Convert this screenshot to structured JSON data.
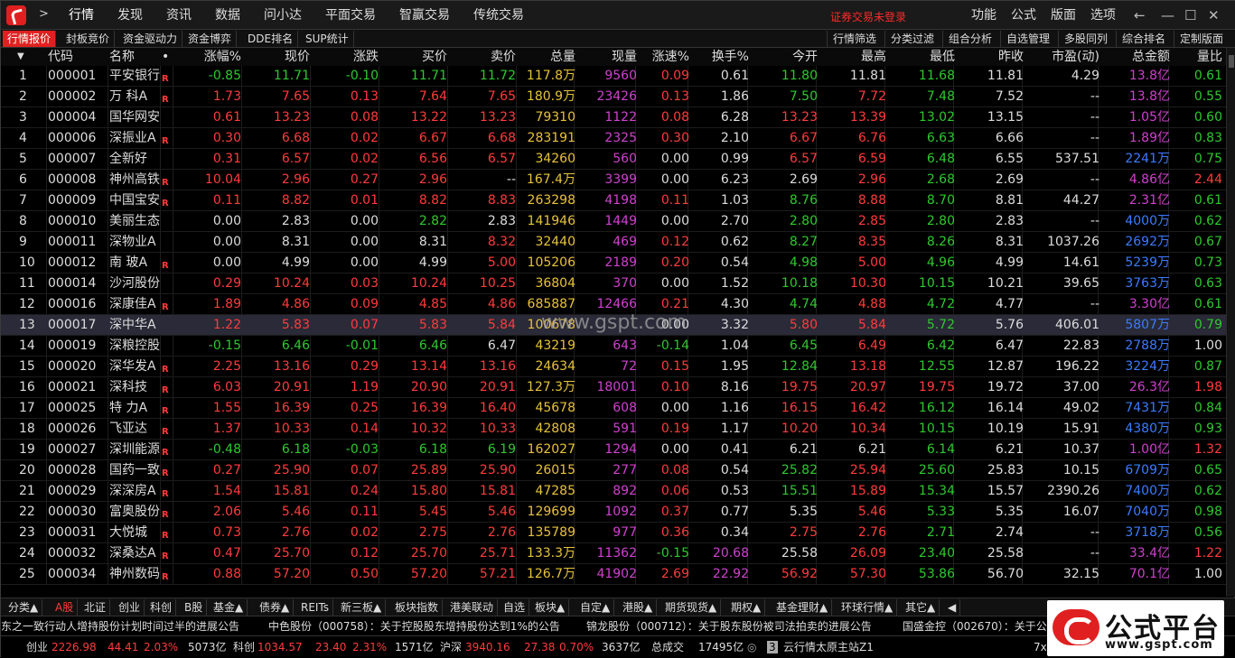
{
  "app": {
    "menu": [
      "行情",
      "发现",
      "资讯",
      "数据",
      "问小达",
      "平面交易",
      "智赢交易",
      "传统交易"
    ],
    "warning": "证券交易未登录",
    "right_menu": [
      "功能",
      "公式",
      "版面",
      "选项"
    ]
  },
  "tabs": [
    "行情报价",
    "封板竞价",
    "资金驱动力",
    "资金博弈",
    "DDE排名",
    "SUP统计"
  ],
  "right_tabs": [
    "行情筛选",
    "分类过滤",
    "组合分析",
    "自选管理",
    "多股同列",
    "综合排名",
    "定制版面"
  ],
  "columns": [
    "",
    "代码",
    "名称",
    "•",
    "涨幅%",
    "现价",
    "涨跌",
    "买价",
    "卖价",
    "总量",
    "现量",
    "涨速%",
    "换手%",
    "今开",
    "最高",
    "最低",
    "昨收",
    "市盈(动)",
    "总金额",
    "量比"
  ],
  "rows": [
    {
      "n": "1",
      "code": "000001",
      "name": "平安银行",
      "r": "R",
      "pct": "-0.85",
      "price": "11.71",
      "chg": "-0.10",
      "bid": "11.71",
      "ask": "11.72",
      "vol": "117.8万",
      "cur": "9560",
      "spd": "0.09",
      "turn": "0.61",
      "open": "11.80",
      "high": "11.81",
      "low": "11.68",
      "prev": "11.81",
      "pe": "4.29",
      "amt": "13.8亿",
      "vr": "0.61"
    },
    {
      "n": "2",
      "code": "000002",
      "name": "万 科A",
      "r": "R",
      "pct": "1.73",
      "price": "7.65",
      "chg": "0.13",
      "bid": "7.64",
      "ask": "7.65",
      "vol": "180.9万",
      "cur": "23426",
      "spd": "0.13",
      "turn": "1.86",
      "open": "7.50",
      "high": "7.72",
      "low": "7.48",
      "prev": "7.52",
      "pe": "--",
      "amt": "13.8亿",
      "vr": "0.55"
    },
    {
      "n": "3",
      "code": "000004",
      "name": "国华网安",
      "r": "",
      "pct": "0.61",
      "price": "13.23",
      "chg": "0.08",
      "bid": "13.22",
      "ask": "13.23",
      "vol": "79310",
      "cur": "1122",
      "spd": "0.08",
      "turn": "6.28",
      "open": "13.23",
      "high": "13.39",
      "low": "13.02",
      "prev": "13.15",
      "pe": "--",
      "amt": "1.05亿",
      "vr": "0.60"
    },
    {
      "n": "4",
      "code": "000006",
      "name": "深振业A",
      "r": "R",
      "pct": "0.30",
      "price": "6.68",
      "chg": "0.02",
      "bid": "6.67",
      "ask": "6.68",
      "vol": "283191",
      "cur": "2325",
      "spd": "0.30",
      "turn": "2.10",
      "open": "6.67",
      "high": "6.76",
      "low": "6.63",
      "prev": "6.66",
      "pe": "--",
      "amt": "1.89亿",
      "vr": "0.83"
    },
    {
      "n": "5",
      "code": "000007",
      "name": "全新好",
      "r": "",
      "pct": "0.31",
      "price": "6.57",
      "chg": "0.02",
      "bid": "6.56",
      "ask": "6.57",
      "vol": "34260",
      "cur": "560",
      "spd": "0.00",
      "turn": "0.99",
      "open": "6.57",
      "high": "6.59",
      "low": "6.48",
      "prev": "6.55",
      "pe": "537.51",
      "amt": "2241万",
      "vr": "0.75"
    },
    {
      "n": "6",
      "code": "000008",
      "name": "神州高铁",
      "r": "R",
      "pct": "10.04",
      "price": "2.96",
      "chg": "0.27",
      "bid": "2.96",
      "ask": "--",
      "vol": "167.4万",
      "cur": "3399",
      "spd": "0.00",
      "turn": "6.23",
      "open": "2.69",
      "high": "2.96",
      "low": "2.68",
      "prev": "2.69",
      "pe": "--",
      "amt": "4.86亿",
      "vr": "2.44"
    },
    {
      "n": "7",
      "code": "000009",
      "name": "中国宝安",
      "r": "R",
      "pct": "0.11",
      "price": "8.82",
      "chg": "0.01",
      "bid": "8.82",
      "ask": "8.83",
      "vol": "263298",
      "cur": "4198",
      "spd": "0.11",
      "turn": "1.03",
      "open": "8.76",
      "high": "8.88",
      "low": "8.70",
      "prev": "8.81",
      "pe": "44.27",
      "amt": "2.31亿",
      "vr": "0.61"
    },
    {
      "n": "8",
      "code": "000010",
      "name": "美丽生态",
      "r": "",
      "pct": "0.00",
      "price": "2.83",
      "chg": "0.00",
      "bid": "2.82",
      "ask": "2.83",
      "vol": "141946",
      "cur": "1449",
      "spd": "0.00",
      "turn": "2.70",
      "open": "2.80",
      "high": "2.85",
      "low": "2.80",
      "prev": "2.83",
      "pe": "--",
      "amt": "4000万",
      "vr": "0.62"
    },
    {
      "n": "9",
      "code": "000011",
      "name": "深物业A",
      "r": "",
      "pct": "0.00",
      "price": "8.31",
      "chg": "0.00",
      "bid": "8.31",
      "ask": "8.32",
      "vol": "32440",
      "cur": "469",
      "spd": "0.12",
      "turn": "0.62",
      "open": "8.27",
      "high": "8.35",
      "low": "8.26",
      "prev": "8.31",
      "pe": "1037.26",
      "amt": "2692万",
      "vr": "0.67"
    },
    {
      "n": "10",
      "code": "000012",
      "name": "南 玻A",
      "r": "R",
      "pct": "0.00",
      "price": "4.99",
      "chg": "0.00",
      "bid": "4.99",
      "ask": "5.00",
      "vol": "105206",
      "cur": "2189",
      "spd": "0.20",
      "turn": "0.54",
      "open": "4.98",
      "high": "5.00",
      "low": "4.96",
      "prev": "4.99",
      "pe": "14.61",
      "amt": "5239万",
      "vr": "0.73"
    },
    {
      "n": "11",
      "code": "000014",
      "name": "沙河股份",
      "r": "",
      "pct": "0.29",
      "price": "10.24",
      "chg": "0.03",
      "bid": "10.24",
      "ask": "10.25",
      "vol": "36804",
      "cur": "370",
      "spd": "0.00",
      "turn": "1.52",
      "open": "10.18",
      "high": "10.30",
      "low": "10.15",
      "prev": "10.21",
      "pe": "39.65",
      "amt": "3763万",
      "vr": "0.63"
    },
    {
      "n": "12",
      "code": "000016",
      "name": "深康佳A",
      "r": "R",
      "pct": "1.89",
      "price": "4.86",
      "chg": "0.09",
      "bid": "4.85",
      "ask": "4.86",
      "vol": "685887",
      "cur": "12466",
      "spd": "0.21",
      "turn": "4.30",
      "open": "4.74",
      "high": "4.88",
      "low": "4.72",
      "prev": "4.77",
      "pe": "--",
      "amt": "3.30亿",
      "vr": "0.61"
    },
    {
      "n": "13",
      "code": "000017",
      "name": "深中华A",
      "r": "",
      "pct": "1.22",
      "price": "5.83",
      "chg": "0.07",
      "bid": "5.83",
      "ask": "5.84",
      "vol": "100678",
      "cur": "",
      "spd": "0.00",
      "turn": "3.32",
      "open": "5.80",
      "high": "5.84",
      "low": "5.72",
      "prev": "5.76",
      "pe": "406.01",
      "amt": "5807万",
      "vr": "0.79"
    },
    {
      "n": "14",
      "code": "000019",
      "name": "深粮控股",
      "r": "",
      "pct": "-0.15",
      "price": "6.46",
      "chg": "-0.01",
      "bid": "6.46",
      "ask": "6.47",
      "vol": "43219",
      "cur": "643",
      "spd": "-0.14",
      "turn": "1.04",
      "open": "6.45",
      "high": "6.49",
      "low": "6.42",
      "prev": "6.47",
      "pe": "22.83",
      "amt": "2788万",
      "vr": "1.00"
    },
    {
      "n": "15",
      "code": "000020",
      "name": "深华发A",
      "r": "R",
      "pct": "2.25",
      "price": "13.16",
      "chg": "0.29",
      "bid": "13.14",
      "ask": "13.16",
      "vol": "24634",
      "cur": "72",
      "spd": "0.15",
      "turn": "1.95",
      "open": "12.84",
      "high": "13.18",
      "low": "12.55",
      "prev": "12.87",
      "pe": "196.22",
      "amt": "3224万",
      "vr": "0.87"
    },
    {
      "n": "16",
      "code": "000021",
      "name": "深科技",
      "r": "R",
      "pct": "6.03",
      "price": "20.91",
      "chg": "1.19",
      "bid": "20.90",
      "ask": "20.91",
      "vol": "127.3万",
      "cur": "18001",
      "spd": "0.10",
      "turn": "8.16",
      "open": "19.75",
      "high": "20.97",
      "low": "19.75",
      "prev": "19.72",
      "pe": "37.00",
      "amt": "26.3亿",
      "vr": "1.98"
    },
    {
      "n": "17",
      "code": "000025",
      "name": "特 力A",
      "r": "R",
      "pct": "1.55",
      "price": "16.39",
      "chg": "0.25",
      "bid": "16.39",
      "ask": "16.40",
      "vol": "45678",
      "cur": "608",
      "spd": "0.00",
      "turn": "1.16",
      "open": "16.15",
      "high": "16.42",
      "low": "16.12",
      "prev": "16.14",
      "pe": "49.02",
      "amt": "7431万",
      "vr": "0.84"
    },
    {
      "n": "18",
      "code": "000026",
      "name": "飞亚达",
      "r": "R",
      "pct": "1.37",
      "price": "10.33",
      "chg": "0.14",
      "bid": "10.32",
      "ask": "10.33",
      "vol": "42808",
      "cur": "591",
      "spd": "0.19",
      "turn": "1.17",
      "open": "10.20",
      "high": "10.34",
      "low": "10.15",
      "prev": "10.19",
      "pe": "15.91",
      "amt": "4380万",
      "vr": "0.93"
    },
    {
      "n": "19",
      "code": "000027",
      "name": "深圳能源",
      "r": "R",
      "pct": "-0.48",
      "price": "6.18",
      "chg": "-0.03",
      "bid": "6.18",
      "ask": "6.19",
      "vol": "162027",
      "cur": "1294",
      "spd": "0.00",
      "turn": "0.41",
      "open": "6.21",
      "high": "6.21",
      "low": "6.14",
      "prev": "6.21",
      "pe": "10.37",
      "amt": "1.00亿",
      "vr": "1.32"
    },
    {
      "n": "20",
      "code": "000028",
      "name": "国药一致",
      "r": "R",
      "pct": "0.27",
      "price": "25.90",
      "chg": "0.07",
      "bid": "25.89",
      "ask": "25.90",
      "vol": "26015",
      "cur": "277",
      "spd": "0.08",
      "turn": "0.54",
      "open": "25.82",
      "high": "25.94",
      "low": "25.60",
      "prev": "25.83",
      "pe": "10.15",
      "amt": "6709万",
      "vr": "0.65"
    },
    {
      "n": "21",
      "code": "000029",
      "name": "深深房A",
      "r": "R",
      "pct": "1.54",
      "price": "15.81",
      "chg": "0.24",
      "bid": "15.80",
      "ask": "15.81",
      "vol": "47285",
      "cur": "892",
      "spd": "0.06",
      "turn": "0.53",
      "open": "15.51",
      "high": "15.89",
      "low": "15.34",
      "prev": "15.57",
      "pe": "2390.26",
      "amt": "7400万",
      "vr": "0.62"
    },
    {
      "n": "22",
      "code": "000030",
      "name": "富奥股份",
      "r": "R",
      "pct": "2.06",
      "price": "5.46",
      "chg": "0.11",
      "bid": "5.45",
      "ask": "5.46",
      "vol": "129699",
      "cur": "1092",
      "spd": "0.37",
      "turn": "0.77",
      "open": "5.35",
      "high": "5.46",
      "low": "5.33",
      "prev": "5.35",
      "pe": "16.07",
      "amt": "7040万",
      "vr": "0.98"
    },
    {
      "n": "23",
      "code": "000031",
      "name": "大悦城",
      "r": "R",
      "pct": "0.73",
      "price": "2.76",
      "chg": "0.02",
      "bid": "2.75",
      "ask": "2.76",
      "vol": "135789",
      "cur": "977",
      "spd": "0.36",
      "turn": "0.34",
      "open": "2.75",
      "high": "2.76",
      "low": "2.71",
      "prev": "2.74",
      "pe": "--",
      "amt": "3718万",
      "vr": "0.56"
    },
    {
      "n": "24",
      "code": "000032",
      "name": "深桑达A",
      "r": "R",
      "pct": "0.47",
      "price": "25.70",
      "chg": "0.12",
      "bid": "25.70",
      "ask": "25.71",
      "vol": "133.3万",
      "cur": "11362",
      "spd": "-0.15",
      "turn": "20.68",
      "open": "25.58",
      "high": "26.09",
      "low": "23.40",
      "prev": "25.58",
      "pe": "--",
      "amt": "33.4亿",
      "vr": "1.22"
    },
    {
      "n": "25",
      "code": "000034",
      "name": "神州数码",
      "r": "R",
      "pct": "0.88",
      "price": "57.20",
      "chg": "0.50",
      "bid": "57.20",
      "ask": "57.21",
      "vol": "126.7万",
      "cur": "41902",
      "spd": "2.69",
      "turn": "22.92",
      "open": "56.92",
      "high": "57.30",
      "low": "53.86",
      "prev": "56.70",
      "pe": "32.15",
      "amt": "70.1亿",
      "vr": "1.00"
    }
  ],
  "bottom_tabs": [
    "分类▲",
    "A股",
    "北证",
    "创业",
    "科创",
    "B股",
    "基金▲",
    "债券▲",
    "REITs",
    "新三板▲",
    "板块指数",
    "港美联动",
    "自选",
    "板块▲",
    "自定▲",
    "港股▲",
    "期货现货▲",
    "期权▲",
    "基金理财▲",
    "环球行情▲",
    "其它▲"
  ],
  "news": [
    "东之一致行动人增持股份计划时间过半的进展公告",
    "中色股份（000758）：关于控股股东增持股份达到1%的公告",
    "锦龙股份（000712）：关于股东股份被司法拍卖的进展公告",
    "国盛金控（002670）：关于公"
  ],
  "status": {
    "cy_label": "创业",
    "cy_val": "2226.98",
    "cy_chg": "44.41",
    "cy_pct": "2.03%",
    "cy_amt": "5073亿",
    "kc_label": "科创",
    "kc_val": "1034.57",
    "kc_chg": "23.40",
    "kc_pct": "2.31%",
    "kc_amt": "1571亿",
    "hs_label": "沪深",
    "hs_val": "3940.16",
    "hs_chg": "27.38",
    "hs_pct": "0.70%",
    "hs_amt": "3637亿",
    "deal_label": "总成交",
    "deal_amt": "17495亿",
    "server": "云行情太原主站Z1",
    "num": "3",
    "tail": "7x"
  },
  "brand": {
    "text": "公式平台",
    "url": "www.gspt.com"
  },
  "watermark": "www.gspt.com"
}
